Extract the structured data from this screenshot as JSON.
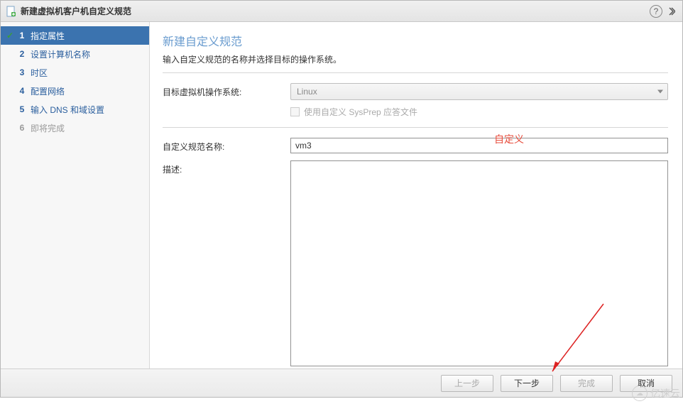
{
  "titlebar": {
    "title": "新建虚拟机客户机自定义规范"
  },
  "sidebar": {
    "steps": [
      {
        "num": "1",
        "label": "指定属性"
      },
      {
        "num": "2",
        "label": "设置计算机名称"
      },
      {
        "num": "3",
        "label": "时区"
      },
      {
        "num": "4",
        "label": "配置网络"
      },
      {
        "num": "5",
        "label": "输入 DNS 和域设置"
      },
      {
        "num": "6",
        "label": "即将完成"
      }
    ]
  },
  "main": {
    "title": "新建自定义规范",
    "subtitle": "输入自定义规范的名称并选择目标的操作系统。",
    "labels": {
      "os": "目标虚拟机操作系统:",
      "sysprep": "使用自定义 SysPrep 应答文件",
      "spec_name": "自定义规范名称:",
      "description": "描述:"
    },
    "fields": {
      "os_value": "Linux",
      "spec_name_value": "vm3",
      "description_value": ""
    }
  },
  "annotation": "自定义",
  "footer": {
    "back": "上一步",
    "next": "下一步",
    "finish": "完成",
    "cancel": "取消"
  },
  "watermark": "亿速云"
}
